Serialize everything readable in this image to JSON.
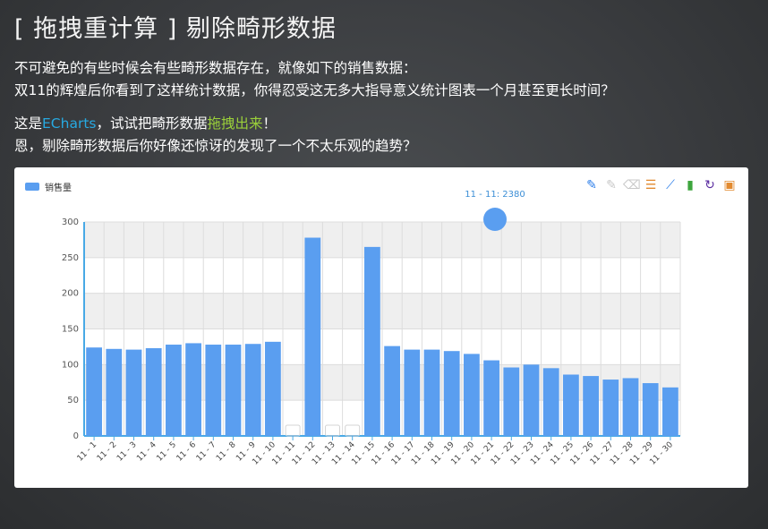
{
  "header": {
    "title": "[ 拖拽重计算 ] 剔除畸形数据"
  },
  "intro": {
    "line1": "不可避免的有些时候会有些畸形数据存在，就像如下的销售数据：",
    "line2": "双11的辉煌后你看到了这样统计数据，你得忍受这无多大指导意义统计图表一个月甚至更长时间？",
    "line3_prefix": "这是",
    "line3_echarts": "ECharts",
    "line3_middle": "，试试把畸形数据",
    "line3_drag": "拖拽出来",
    "line3_suffix": "！",
    "line4": "恩，剔除畸形数据后你好像还惊讶的发现了一个不太乐观的趋势？"
  },
  "toolbox": {
    "icons": [
      {
        "name": "mark-icon",
        "glyph": "✎",
        "color": "#2b7de9"
      },
      {
        "name": "mark-undo-icon",
        "glyph": "✎",
        "color": "#c8c8c8"
      },
      {
        "name": "mark-clear-icon",
        "glyph": "⌫",
        "color": "#c8c8c8"
      },
      {
        "name": "data-view-icon",
        "glyph": "☰",
        "color": "#e28a2f"
      },
      {
        "name": "line-chart-icon",
        "glyph": "⟋",
        "color": "#2b7de9"
      },
      {
        "name": "bar-chart-icon",
        "glyph": "▮",
        "color": "#3ea53e"
      },
      {
        "name": "refresh-icon",
        "glyph": "↻",
        "color": "#5a2ca0"
      },
      {
        "name": "save-image-icon",
        "glyph": "▣",
        "color": "#e28a2f"
      }
    ]
  },
  "chart_data": {
    "type": "bar",
    "legend": [
      "销售量"
    ],
    "legend_position": "top-left",
    "color": "#5a9ef0",
    "grid": true,
    "ylim": [
      0,
      300
    ],
    "yticks": [
      0,
      50,
      100,
      150,
      200,
      250,
      300
    ],
    "categories": [
      "11 - 1",
      "11 - 2",
      "11 - 3",
      "11 - 4",
      "11 - 5",
      "11 - 6",
      "11 - 7",
      "11 - 8",
      "11 - 9",
      "11 - 10",
      "11 - 11",
      "11 - 12",
      "11 - 13",
      "11 - 14",
      "11 - 15",
      "11 - 16",
      "11 - 17",
      "11 - 18",
      "11 - 19",
      "11 - 20",
      "11 - 21",
      "11 - 22",
      "11 - 23",
      "11 - 24",
      "11 - 25",
      "11 - 26",
      "11 - 27",
      "11 - 28",
      "11 - 29",
      "11 - 30"
    ],
    "series": [
      {
        "name": "销售量",
        "values": [
          124,
          122,
          121,
          123,
          128,
          130,
          128,
          128,
          129,
          132,
          null,
          278,
          null,
          null,
          265,
          126,
          121,
          121,
          119,
          115,
          106,
          96,
          100,
          95,
          86,
          84,
          79,
          81,
          74,
          68
        ]
      }
    ],
    "dragged_out": {
      "label": "11 - 11: 2380"
    }
  }
}
